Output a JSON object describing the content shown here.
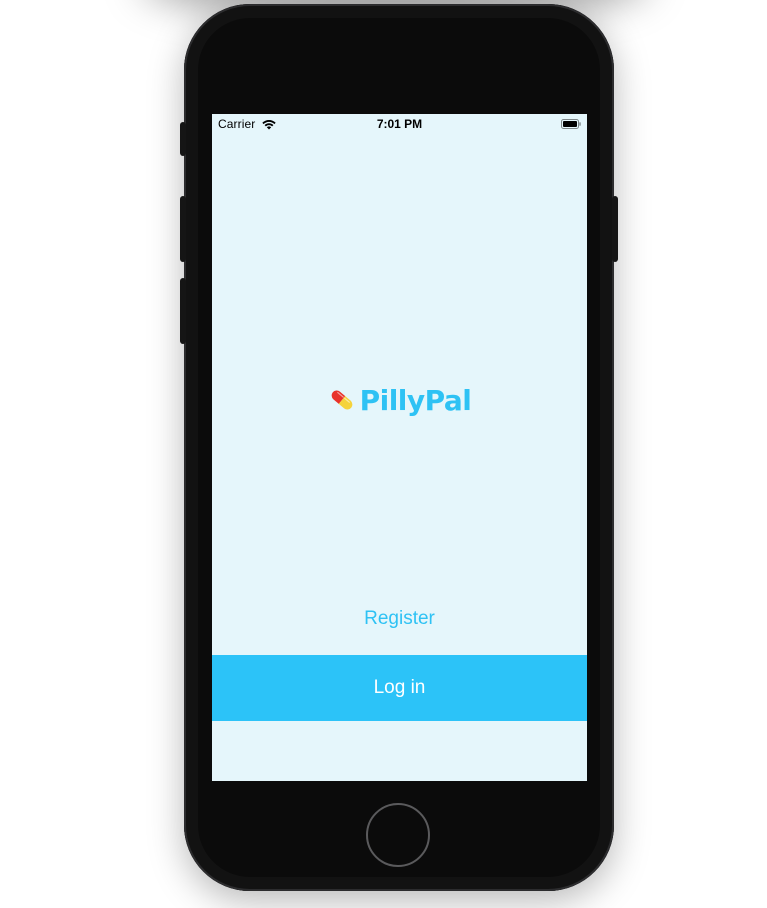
{
  "status_bar": {
    "carrier": "Carrier",
    "time": "7:01 PM",
    "wifi_icon": "wifi-icon",
    "battery_icon": "battery-icon"
  },
  "app": {
    "name": "PillyPal",
    "logo_icon": "pill-icon"
  },
  "actions": {
    "register_label": "Register",
    "login_label": "Log in"
  },
  "colors": {
    "screen_background": "#e5f6fb",
    "brand": "#2ec2f4",
    "login_button": "#2cc3f8",
    "login_text": "#ffffff"
  }
}
